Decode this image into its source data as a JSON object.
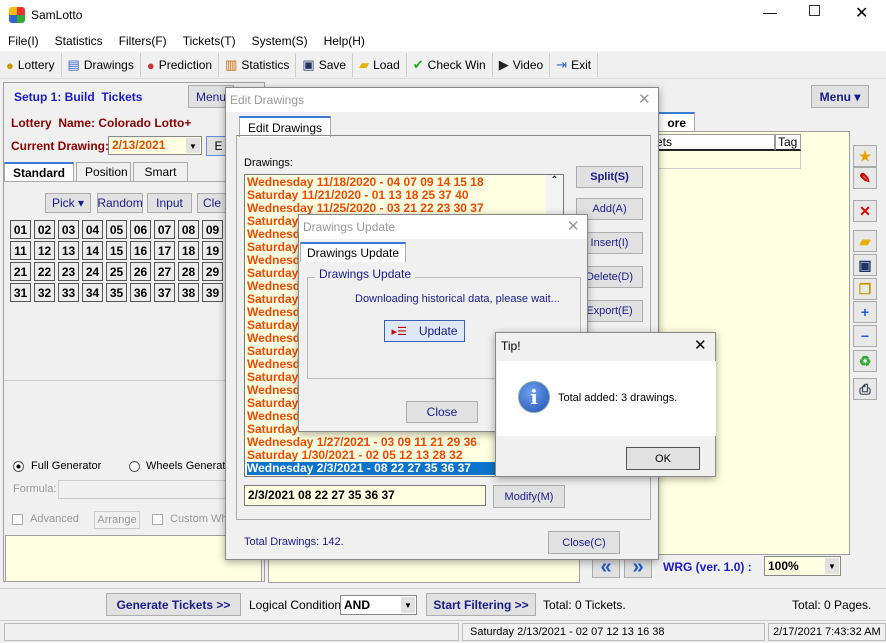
{
  "window": {
    "title": "SamLotto"
  },
  "menu": [
    "File(I)",
    "Statistics",
    "Filters(F)",
    "Tickets(T)",
    "System(S)",
    "Help(H)"
  ],
  "toolbar": [
    {
      "label": "Lottery",
      "icon": "lottery-ball-icon"
    },
    {
      "label": "Drawings",
      "icon": "drawings-icon"
    },
    {
      "label": "Prediction",
      "icon": "prediction-icon"
    },
    {
      "label": "Statistics",
      "icon": "bar-chart-icon"
    },
    {
      "label": "Save",
      "icon": "save-icon"
    },
    {
      "label": "Load",
      "icon": "folder-open-icon"
    },
    {
      "label": "Check Win",
      "icon": "checkmark-icon"
    },
    {
      "label": "Video",
      "icon": "play-icon"
    },
    {
      "label": "Exit",
      "icon": "exit-icon"
    }
  ],
  "left": {
    "setup_title": "Setup 1: Build  Tickets",
    "menu_label": "Menu",
    "lottery_name": "Lottery  Name: Colorado Lotto+",
    "current_drawing_label": "Current Drawing:",
    "current_drawing": "2/13/2021",
    "e_button": "E",
    "tabs": [
      "Standard",
      "Position",
      "Smart"
    ],
    "buttons": [
      "Pick ▾",
      "Random",
      "Input",
      "Cle"
    ],
    "numbers": [
      "01",
      "02",
      "03",
      "04",
      "05",
      "06",
      "07",
      "08",
      "09",
      "11",
      "12",
      "13",
      "14",
      "15",
      "16",
      "17",
      "18",
      "19",
      "21",
      "22",
      "23",
      "24",
      "25",
      "26",
      "27",
      "28",
      "29",
      "31",
      "32",
      "33",
      "34",
      "35",
      "36",
      "37",
      "38",
      "39"
    ],
    "full_generator": "Full Generator",
    "wheels_generator": "Wheels Generato",
    "formula_label": "Formula:",
    "advanced": "Advanced",
    "arrange": "Arrange",
    "custom": "Custom Wh"
  },
  "right": {
    "menu_label": "Menu ▾",
    "tab": "ore",
    "col_tickets": "kets",
    "col_tag": "Tag",
    "wrg": "WRG (ver. 1.0) :",
    "zoom": "100%",
    "prev": "«",
    "next": "»",
    "side_icons": [
      "star-folder-icon",
      "eraser-icon",
      "delete-icon",
      "open-icon",
      "save-icon",
      "copy-icon",
      "add-icon",
      "remove-icon",
      "recycle-icon",
      "print-icon"
    ]
  },
  "bottom": {
    "generate": "Generate Tickets >>",
    "logical_label": "Logical Condition:",
    "logical_value": "AND",
    "start_filtering": "Start Filtering >>",
    "total_tickets": "Total: 0 Tickets.",
    "total_pages": "Total: 0 Pages."
  },
  "status": {
    "drawing": "Saturday 2/13/2021 - 02 07 12 13 16 38",
    "datetime": "2/17/2021 7:43:32 AM"
  },
  "edit_drawings": {
    "title": "Edit Drawings",
    "tab": "Edit Drawings",
    "list_label": "Drawings:",
    "rows": [
      "Wednesday 11/18/2020 - 04 07 09 14 15 18",
      "Saturday 11/21/2020 - 01 13 18 25 37 40",
      "Wednesday 11/25/2020 - 03 21 22 23 30 37",
      "Saturday",
      "Wednesd",
      "Saturday",
      "Wednesd",
      "Saturday",
      "Wednesd",
      "Saturday",
      "Wednesd",
      "Saturday",
      "Wednesd",
      "Saturday",
      "Wednesd",
      "Saturday",
      "Wednesd",
      "Saturday",
      "Wednesd",
      "Saturday",
      "Wednesday 1/27/2021 - 03 09 11 21 29 36",
      "Saturday 1/30/2021 - 02 05 12 13 28 32",
      "Wednesday 2/3/2021 - 08 22 27 35 36 37"
    ],
    "selected_index": 22,
    "buttons": [
      "Split(S)",
      "Add(A)",
      "Insert(I)",
      "Delete(D)",
      "Export(E)"
    ],
    "edit_value": "2/3/2021 08 22 27 35 36 37",
    "modify": "Modify(M)",
    "total": "Total Drawings: 142.",
    "close": "Close(C)"
  },
  "drawings_update": {
    "title": "Drawings Update",
    "tab": "Drawings Update",
    "group": "Drawings Update",
    "message": "Downloading historical data, please wait...",
    "update": "Update",
    "close": "Close"
  },
  "tip": {
    "title": "Tip!",
    "message": "Total added: 3 drawings.",
    "ok": "OK"
  }
}
